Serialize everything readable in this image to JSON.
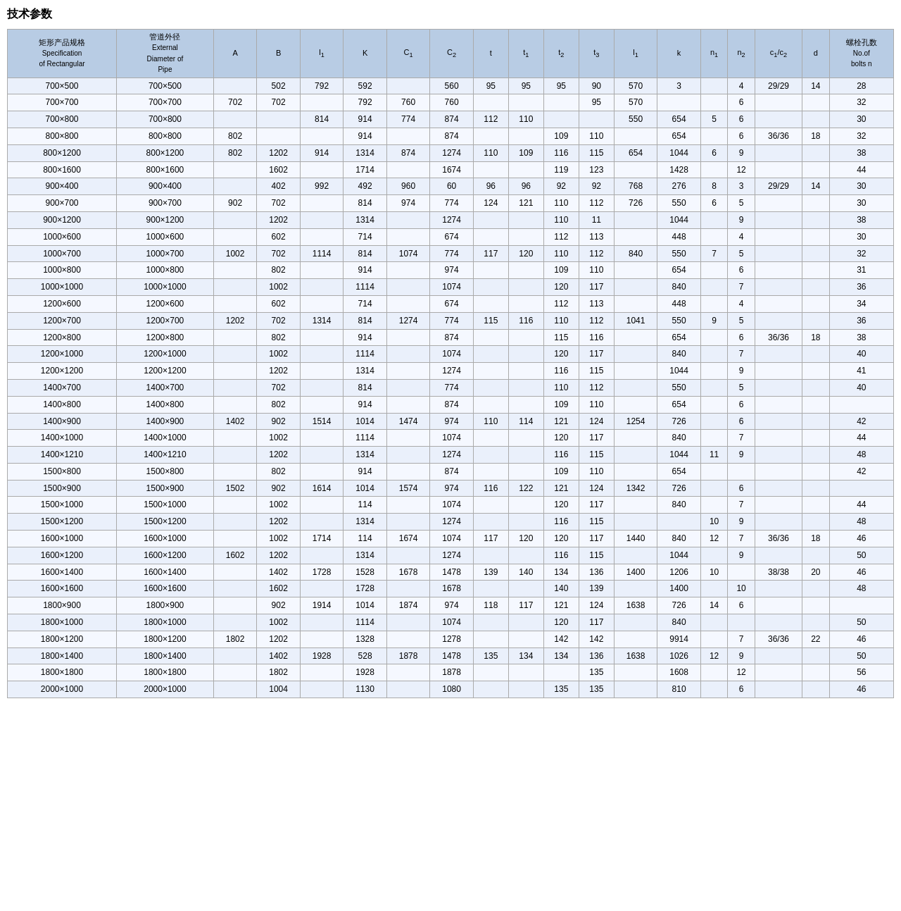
{
  "title": "技术参数",
  "headers": [
    {
      "label": "矩形产品规格\nSpecification\nof Rectangular",
      "rowspan": 1
    },
    {
      "label": "管道外径\nExternal\nDiameter of\nPipe",
      "rowspan": 1
    },
    {
      "label": "A"
    },
    {
      "label": "B"
    },
    {
      "label": "l₁"
    },
    {
      "label": "K"
    },
    {
      "label": "C₁"
    },
    {
      "label": "C₂"
    },
    {
      "label": "t"
    },
    {
      "label": "t₁"
    },
    {
      "label": "t₂"
    },
    {
      "label": "t₃"
    },
    {
      "label": "l₁"
    },
    {
      "label": "k"
    },
    {
      "label": "n₁"
    },
    {
      "label": "n₂"
    },
    {
      "label": "c₁/c₂"
    },
    {
      "label": "d"
    },
    {
      "label": "螺栓孔数\nNo.of\nbolts n"
    }
  ],
  "rows": [
    [
      "700×500",
      "700×500",
      "",
      "502",
      "792",
      "592",
      "",
      "560",
      "95",
      "95",
      "95",
      "90",
      "570",
      "3",
      "",
      "4",
      "29/29",
      "14",
      "28"
    ],
    [
      "700×700",
      "700×700",
      "702",
      "702",
      "",
      "792",
      "760",
      "760",
      "",
      "",
      "",
      "95",
      "570",
      "",
      "",
      "6",
      "",
      "",
      "32"
    ],
    [
      "700×800",
      "700×800",
      "",
      "",
      "814",
      "914",
      "774",
      "874",
      "112",
      "110",
      "",
      "",
      "550",
      "654",
      "5",
      "6",
      "",
      "",
      "30"
    ],
    [
      "800×800",
      "800×800",
      "802",
      "",
      "",
      "914",
      "",
      "874",
      "",
      "",
      "109",
      "110",
      "",
      "654",
      "",
      "6",
      "36/36",
      "18",
      "32"
    ],
    [
      "800×1200",
      "800×1200",
      "802",
      "1202",
      "914",
      "1314",
      "874",
      "1274",
      "110",
      "109",
      "116",
      "115",
      "654",
      "1044",
      "6",
      "9",
      "",
      "",
      "38"
    ],
    [
      "800×1600",
      "800×1600",
      "",
      "1602",
      "",
      "1714",
      "",
      "1674",
      "",
      "",
      "119",
      "123",
      "",
      "1428",
      "",
      "12",
      "",
      "",
      "44"
    ],
    [
      "900×400",
      "900×400",
      "",
      "402",
      "992",
      "492",
      "960",
      "60",
      "96",
      "96",
      "92",
      "92",
      "768",
      "276",
      "8",
      "3",
      "29/29",
      "14",
      "30"
    ],
    [
      "900×700",
      "900×700",
      "902",
      "702",
      "",
      "814",
      "974",
      "774",
      "124",
      "121",
      "110",
      "112",
      "726",
      "550",
      "6",
      "5",
      "",
      "",
      "30"
    ],
    [
      "900×1200",
      "900×1200",
      "",
      "1202",
      "",
      "1314",
      "",
      "1274",
      "",
      "",
      "110",
      "11",
      "",
      "1044",
      "",
      "9",
      "",
      "",
      "38"
    ],
    [
      "1000×600",
      "1000×600",
      "",
      "602",
      "",
      "714",
      "",
      "674",
      "",
      "",
      "112",
      "113",
      "",
      "448",
      "",
      "4",
      "",
      "",
      "30"
    ],
    [
      "1000×700",
      "1000×700",
      "1002",
      "702",
      "1114",
      "814",
      "1074",
      "774",
      "117",
      "120",
      "110",
      "112",
      "840",
      "550",
      "7",
      "5",
      "",
      "",
      "32"
    ],
    [
      "1000×800",
      "1000×800",
      "",
      "802",
      "",
      "914",
      "",
      "974",
      "",
      "",
      "109",
      "110",
      "",
      "654",
      "",
      "6",
      "",
      "",
      "31"
    ],
    [
      "1000×1000",
      "1000×1000",
      "",
      "1002",
      "",
      "1114",
      "",
      "1074",
      "",
      "",
      "120",
      "117",
      "",
      "840",
      "",
      "7",
      "",
      "",
      "36"
    ],
    [
      "1200×600",
      "1200×600",
      "",
      "602",
      "",
      "714",
      "",
      "674",
      "",
      "",
      "112",
      "113",
      "",
      "448",
      "",
      "4",
      "",
      "",
      "34"
    ],
    [
      "1200×700",
      "1200×700",
      "1202",
      "702",
      "1314",
      "814",
      "1274",
      "774",
      "115",
      "116",
      "110",
      "112",
      "1041",
      "550",
      "9",
      "5",
      "",
      "",
      "36"
    ],
    [
      "1200×800",
      "1200×800",
      "",
      "802",
      "",
      "914",
      "",
      "874",
      "",
      "",
      "115",
      "116",
      "",
      "654",
      "",
      "6",
      "36/36",
      "18",
      "38"
    ],
    [
      "1200×1000",
      "1200×1000",
      "",
      "1002",
      "",
      "1114",
      "",
      "1074",
      "",
      "",
      "120",
      "117",
      "",
      "840",
      "",
      "7",
      "",
      "",
      "40"
    ],
    [
      "1200×1200",
      "1200×1200",
      "",
      "1202",
      "",
      "1314",
      "",
      "1274",
      "",
      "",
      "116",
      "115",
      "",
      "1044",
      "",
      "9",
      "",
      "",
      "41"
    ],
    [
      "1400×700",
      "1400×700",
      "",
      "702",
      "",
      "814",
      "",
      "774",
      "",
      "",
      "110",
      "112",
      "",
      "550",
      "",
      "5",
      "",
      "",
      "40"
    ],
    [
      "1400×800",
      "1400×800",
      "",
      "802",
      "",
      "914",
      "",
      "874",
      "",
      "",
      "109",
      "110",
      "",
      "654",
      "",
      "6",
      "",
      "",
      ""
    ],
    [
      "1400×900",
      "1400×900",
      "1402",
      "902",
      "1514",
      "1014",
      "1474",
      "974",
      "110",
      "114",
      "121",
      "124",
      "1254",
      "726",
      "",
      "6",
      "",
      "",
      "42"
    ],
    [
      "1400×1000",
      "1400×1000",
      "",
      "1002",
      "",
      "1114",
      "",
      "1074",
      "",
      "",
      "120",
      "117",
      "",
      "840",
      "",
      "7",
      "",
      "",
      "44"
    ],
    [
      "1400×1210",
      "1400×1210",
      "",
      "1202",
      "",
      "1314",
      "",
      "1274",
      "",
      "",
      "116",
      "115",
      "",
      "1044",
      "11",
      "9",
      "",
      "",
      "48"
    ],
    [
      "1500×800",
      "1500×800",
      "",
      "802",
      "",
      "914",
      "",
      "874",
      "",
      "",
      "109",
      "110",
      "",
      "654",
      "",
      "",
      "",
      "",
      "42"
    ],
    [
      "1500×900",
      "1500×900",
      "1502",
      "902",
      "1614",
      "1014",
      "1574",
      "974",
      "116",
      "122",
      "121",
      "124",
      "1342",
      "726",
      "",
      "6",
      "",
      "",
      ""
    ],
    [
      "1500×1000",
      "1500×1000",
      "",
      "1002",
      "",
      "114",
      "",
      "1074",
      "",
      "",
      "120",
      "117",
      "",
      "840",
      "",
      "7",
      "",
      "",
      "44"
    ],
    [
      "1500×1200",
      "1500×1200",
      "",
      "1202",
      "",
      "1314",
      "",
      "1274",
      "",
      "",
      "116",
      "115",
      "",
      "",
      "10",
      "9",
      "",
      "",
      "48"
    ],
    [
      "1600×1000",
      "1600×1000",
      "",
      "1002",
      "1714",
      "114",
      "1674",
      "1074",
      "117",
      "120",
      "120",
      "117",
      "1440",
      "840",
      "12",
      "7",
      "36/36",
      "18",
      "46"
    ],
    [
      "1600×1200",
      "1600×1200",
      "1602",
      "1202",
      "",
      "1314",
      "",
      "1274",
      "",
      "",
      "116",
      "115",
      "",
      "1044",
      "",
      "9",
      "",
      "",
      "50"
    ],
    [
      "1600×1400",
      "1600×1400",
      "",
      "1402",
      "1728",
      "1528",
      "1678",
      "1478",
      "139",
      "140",
      "134",
      "136",
      "1400",
      "1206",
      "10",
      "",
      "38/38",
      "20",
      "46"
    ],
    [
      "1600×1600",
      "1600×1600",
      "",
      "1602",
      "",
      "1728",
      "",
      "1678",
      "",
      "",
      "140",
      "139",
      "",
      "1400",
      "",
      "10",
      "",
      "",
      "48"
    ],
    [
      "1800×900",
      "1800×900",
      "",
      "902",
      "1914",
      "1014",
      "1874",
      "974",
      "118",
      "117",
      "121",
      "124",
      "1638",
      "726",
      "14",
      "6",
      "",
      "",
      ""
    ],
    [
      "1800×1000",
      "1800×1000",
      "",
      "1002",
      "",
      "1114",
      "",
      "1074",
      "",
      "",
      "120",
      "117",
      "",
      "840",
      "",
      "",
      "",
      "",
      "50"
    ],
    [
      "1800×1200",
      "1800×1200",
      "1802",
      "1202",
      "",
      "1328",
      "",
      "1278",
      "",
      "",
      "142",
      "142",
      "",
      "9914",
      "",
      "7",
      "36/36",
      "22",
      "46"
    ],
    [
      "1800×1400",
      "1800×1400",
      "",
      "1402",
      "1928",
      "528",
      "1878",
      "1478",
      "135",
      "134",
      "134",
      "136",
      "1638",
      "1026",
      "12",
      "9",
      "",
      "",
      "50"
    ],
    [
      "1800×1800",
      "1800×1800",
      "",
      "1802",
      "",
      "1928",
      "",
      "1878",
      "",
      "",
      "",
      "135",
      "",
      "1608",
      "",
      "12",
      "",
      "",
      "56"
    ],
    [
      "2000×1000",
      "2000×1000",
      "",
      "1004",
      "",
      "1130",
      "",
      "1080",
      "",
      "",
      "135",
      "135",
      "",
      "810",
      "",
      "6",
      "",
      "",
      "46"
    ]
  ]
}
